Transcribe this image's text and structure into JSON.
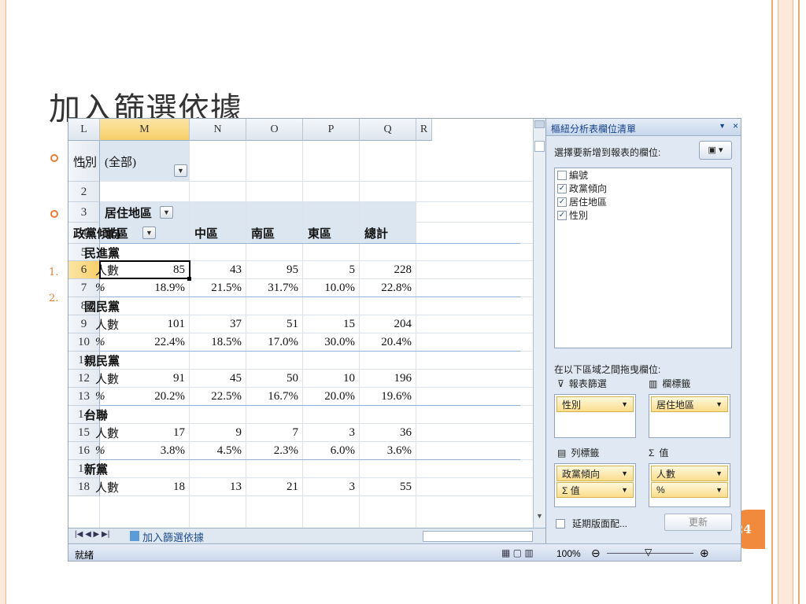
{
  "slide": {
    "title": "加入篩選依據",
    "page_number": "24",
    "numbers": [
      "1.",
      "2."
    ]
  },
  "excel": {
    "columns": [
      "L",
      "M",
      "N",
      "O",
      "P",
      "Q",
      "R"
    ],
    "rows": [
      "1",
      "2",
      "3",
      "4",
      "5",
      "6",
      "7",
      "8",
      "9",
      "10",
      "11",
      "12",
      "13",
      "14",
      "15",
      "16",
      "17",
      "18"
    ],
    "filter": {
      "label": "性別",
      "value": "(全部)"
    },
    "col_field": "居住地區",
    "row_field": "政黨傾向",
    "headers": [
      "北區",
      "中區",
      "南區",
      "東區",
      "總計"
    ],
    "parties": [
      {
        "name": "民進黨",
        "count_label": "人數",
        "counts": [
          "85",
          "43",
          "95",
          "5",
          "228"
        ],
        "pct_label": "%",
        "pcts": [
          "18.9%",
          "21.5%",
          "31.7%",
          "10.0%",
          "22.8%"
        ]
      },
      {
        "name": "國民黨",
        "count_label": "人數",
        "counts": [
          "101",
          "37",
          "51",
          "15",
          "204"
        ],
        "pct_label": "%",
        "pcts": [
          "22.4%",
          "18.5%",
          "17.0%",
          "30.0%",
          "20.4%"
        ]
      },
      {
        "name": "親民黨",
        "count_label": "人數",
        "counts": [
          "91",
          "45",
          "50",
          "10",
          "196"
        ],
        "pct_label": "%",
        "pcts": [
          "20.2%",
          "22.5%",
          "16.7%",
          "20.0%",
          "19.6%"
        ]
      },
      {
        "name": "台聯",
        "count_label": "人數",
        "counts": [
          "17",
          "9",
          "7",
          "3",
          "36"
        ],
        "pct_label": "%",
        "pcts": [
          "3.8%",
          "4.5%",
          "2.3%",
          "6.0%",
          "3.6%"
        ]
      },
      {
        "name": "新黨",
        "count_label": "人數",
        "counts": [
          "18",
          "13",
          "21",
          "3",
          "55"
        ]
      }
    ],
    "sheet_tab": "加入篩選依據",
    "status": "就緒",
    "zoom": "100%"
  },
  "pivot_panel": {
    "title": "樞紐分析表欄位清單",
    "choose_label": "選擇要新增到報表的欄位:",
    "fields": [
      {
        "label": "編號",
        "checked": false
      },
      {
        "label": "政黨傾向",
        "checked": true
      },
      {
        "label": "居住地區",
        "checked": true
      },
      {
        "label": "性別",
        "checked": true
      }
    ],
    "drag_label": "在以下區域之間拖曳欄位:",
    "filter_area": "報表篩選",
    "col_area": "欄標籤",
    "row_area": "列標籤",
    "val_area": "值",
    "filter_chip": "性別",
    "col_chip": "居住地區",
    "row_chips": [
      "政黨傾向",
      "Σ 值"
    ],
    "val_chips": [
      "人數",
      "%"
    ],
    "defer_label": "延期版面配...",
    "update_label": "更新"
  }
}
